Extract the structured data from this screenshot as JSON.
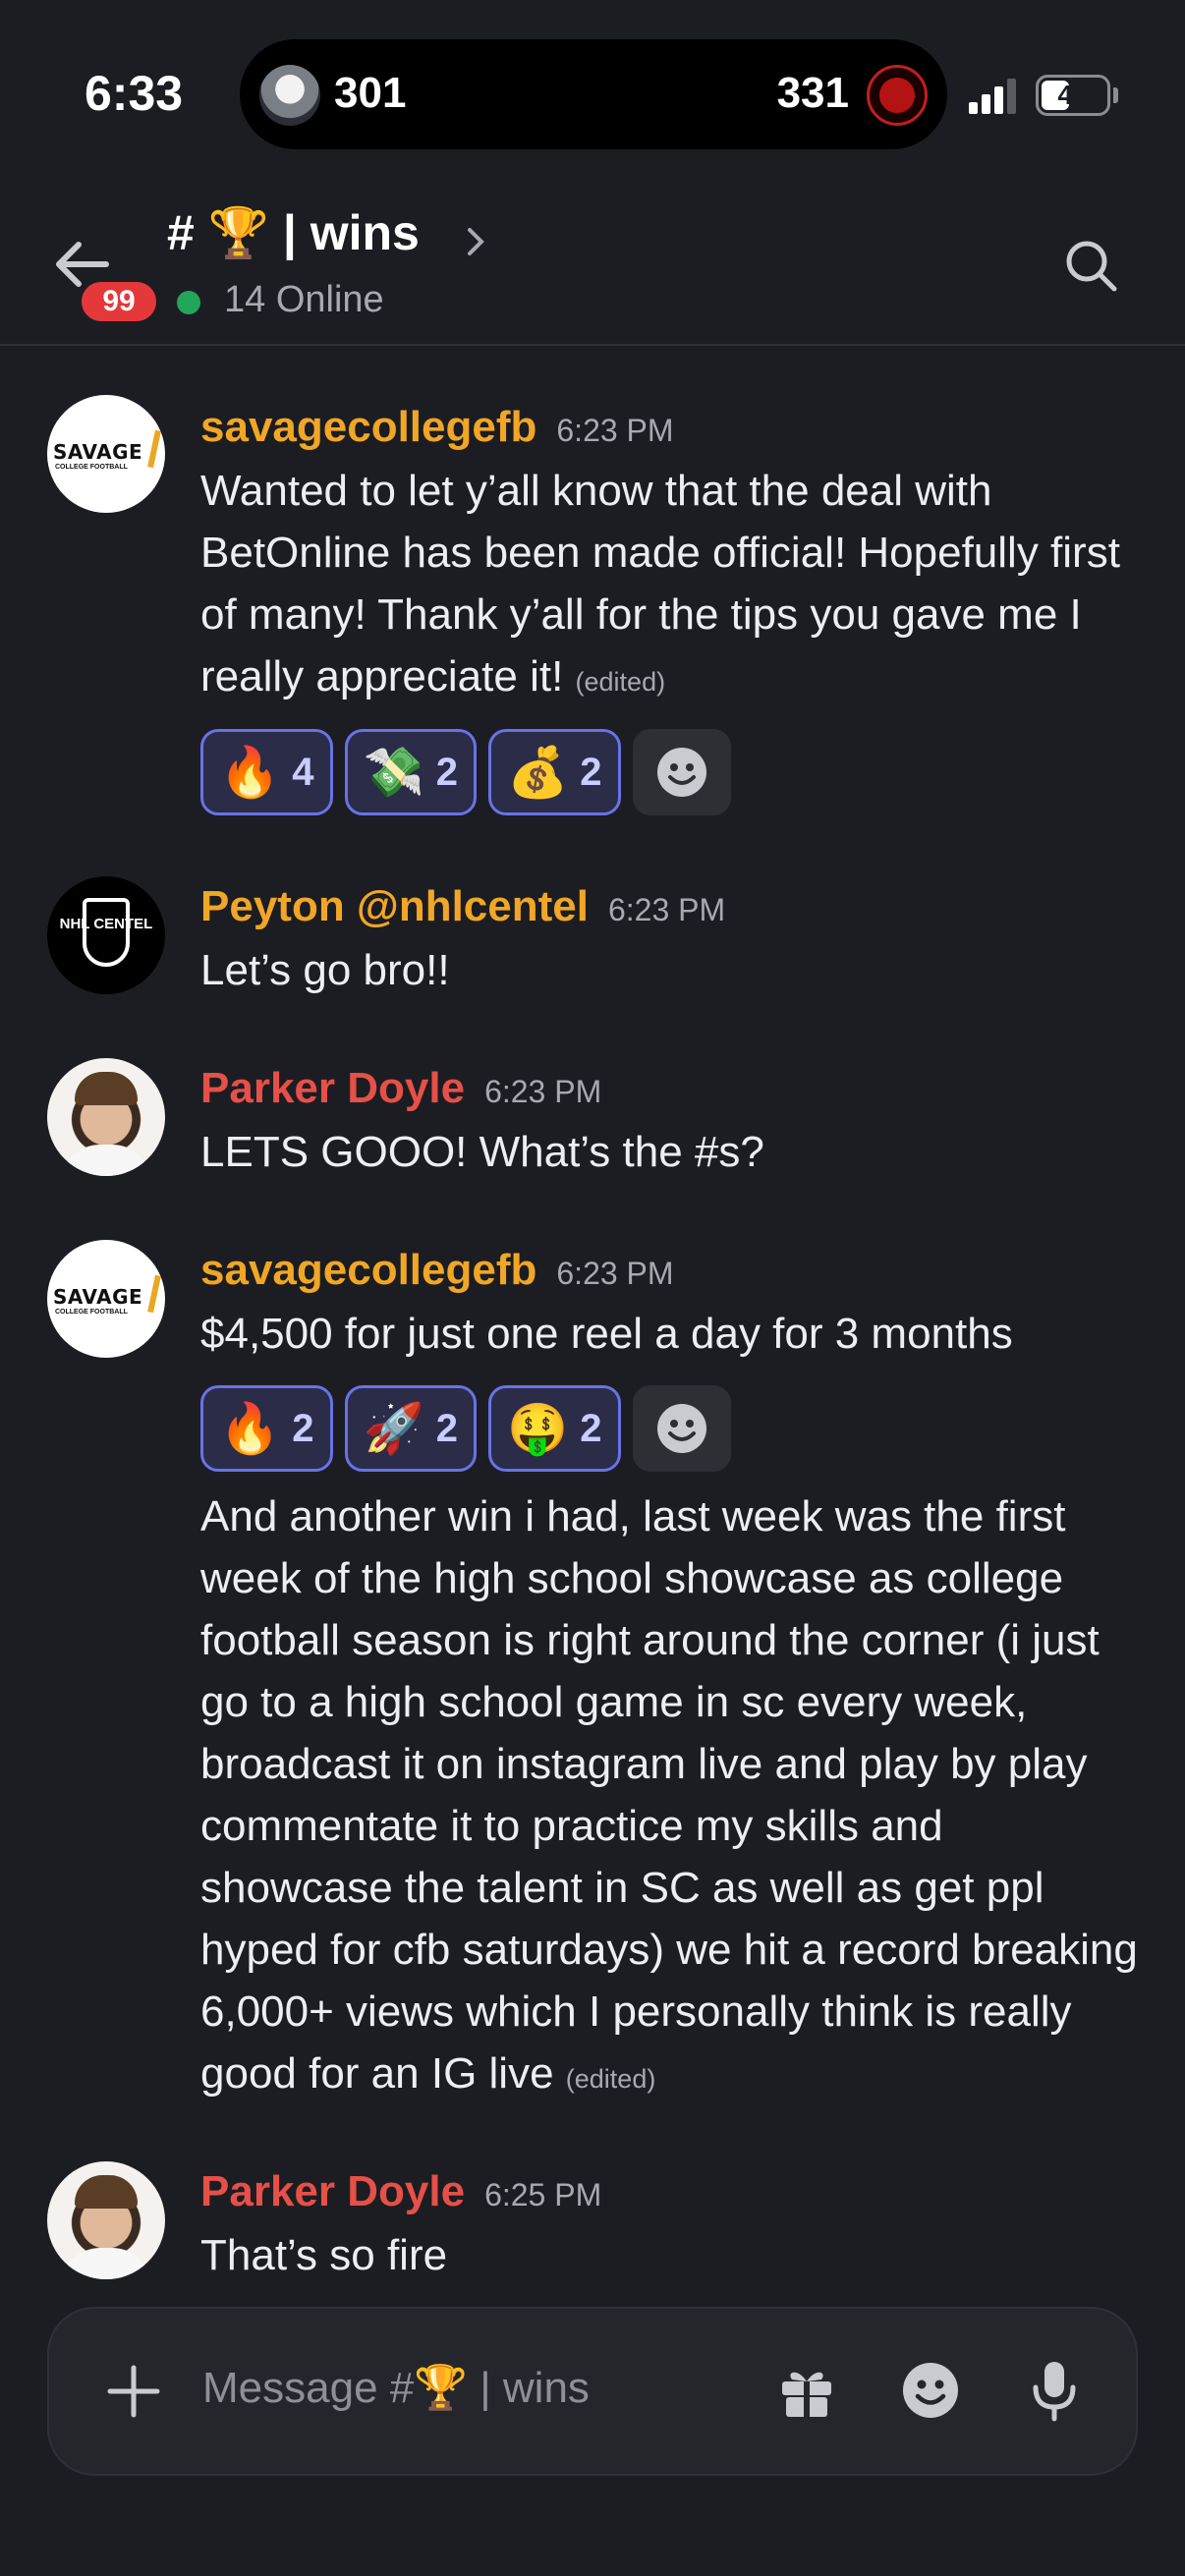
{
  "status": {
    "time": "6:33",
    "island_left_count": "301",
    "island_right_count": "331",
    "battery": "40"
  },
  "header": {
    "title": "# 🏆 | wins",
    "unread_badge": "99",
    "online": "14 Online"
  },
  "messages": [
    {
      "author": "savagecollegefb",
      "time": "6:23 PM",
      "text": "Wanted to let y’all know that the deal with BetOnline has been made official! Hopefully first of many! Thank y’all for the tips you gave me I really appreciate it!",
      "edited": "(edited)",
      "reactions": [
        {
          "emoji": "🔥",
          "count": "4"
        },
        {
          "emoji": "💸",
          "count": "2"
        },
        {
          "emoji": "💰",
          "count": "2"
        }
      ]
    },
    {
      "author": "Peyton @nhlcentel",
      "time": "6:23 PM",
      "text": "Let’s go bro!!"
    },
    {
      "author": "Parker Doyle",
      "time": "6:23 PM",
      "text": "LETS GOOO! What’s the #s?"
    },
    {
      "author": "savagecollegefb",
      "time": "6:23 PM",
      "text": "$4,500 for just one reel a day for 3 months",
      "reactions": [
        {
          "emoji": "🔥",
          "count": "2"
        },
        {
          "emoji": "🚀",
          "count": "2"
        },
        {
          "emoji": "🤑",
          "count": "2"
        }
      ],
      "followup": "And another win i had, last week was the first week of the high school showcase as college football season is right around the corner (i just go to a high school game in sc every week, broadcast it on instagram live and play by play commentate it to practice my skills and showcase the talent in SC as well as get ppl hyped for cfb saturdays) we hit a record breaking 6,000+ views which I personally think is really good for an IG live",
      "followup_edited": "(edited)"
    },
    {
      "author": "Parker Doyle",
      "time": "6:25 PM",
      "text": "That’s so fire"
    }
  ],
  "avatars": {
    "savage_text": "SAVAGE",
    "savage_sub": "COLLEGE FOOTBALL",
    "nhl_text": "NHL CENTEL"
  },
  "composer": {
    "placeholder": "Message #🏆 | wins"
  },
  "colors": {
    "background": "#1c1d22",
    "gold_name": "#f0a626",
    "red_name": "#e55048",
    "reaction_border": "#6a72e6",
    "online": "#23a55a"
  },
  "icons": [
    "back-arrow-icon",
    "chevron-right-icon",
    "search-icon",
    "add-reaction-icon",
    "plus-icon",
    "gift-icon",
    "emoji-icon",
    "microphone-icon"
  ]
}
